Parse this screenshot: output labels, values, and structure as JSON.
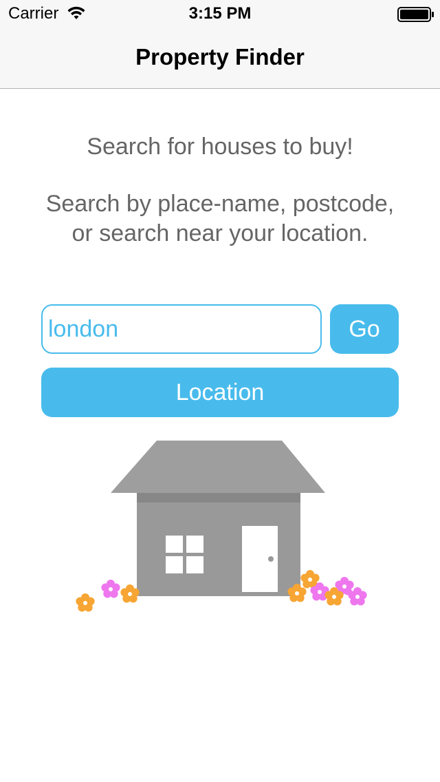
{
  "status_bar": {
    "carrier": "Carrier",
    "time": "3:15 PM",
    "wifi_icon": "wifi-icon",
    "battery_icon": "battery-full-icon"
  },
  "nav": {
    "title": "Property Finder"
  },
  "main": {
    "heading": "Search for houses to buy!",
    "instructions": "Search by place-name, postcode, or search near your location.",
    "search": {
      "value": "london",
      "placeholder": ""
    },
    "go_label": "Go",
    "location_label": "Location",
    "illustration_icon": "house-illustration"
  },
  "colors": {
    "accent": "#48bbec",
    "text_gray": "#656565",
    "house_gray": "#999999",
    "roof_gray": "#9e9e9e",
    "flower_orange": "#f7a533",
    "flower_pink": "#ee77ee"
  }
}
